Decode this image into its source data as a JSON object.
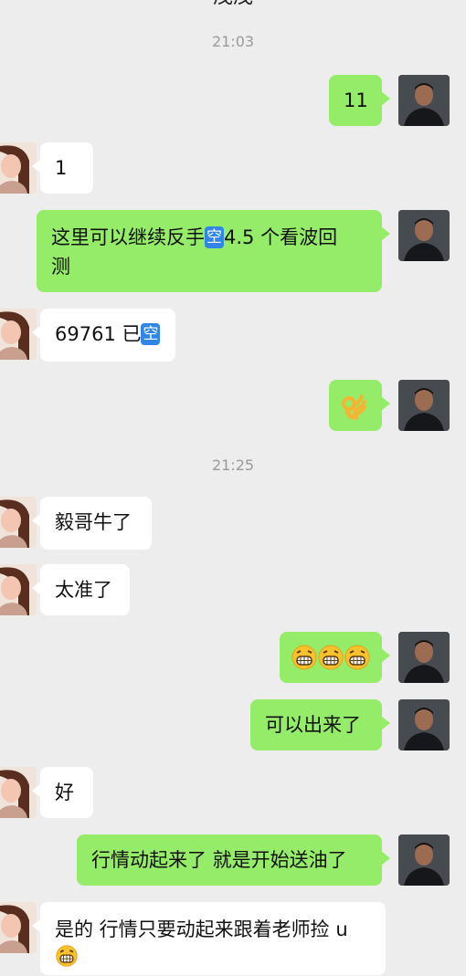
{
  "header": {
    "title": "茂茂"
  },
  "timestamps": [
    "21:03",
    "21:25"
  ],
  "messages": {
    "m1": "11",
    "m2": "1",
    "m3_a": "这里可以继续反手",
    "m3_badge": "空",
    "m3_b": "4.5 个看波回",
    "m3_c": "测",
    "m4_a": "69761 已",
    "m4_badge": "空",
    "m5_emoji": "ok-hand-emoji",
    "m6": "毅哥牛了",
    "m7": "太准了",
    "m8_emoji": "grinning-face-emoji x3",
    "m9": "可以出来了",
    "m10": "好",
    "m11": "行情动起来了 就是开始送油了",
    "m12_a": "是的 行情只要动起来跟着老师捡 u",
    "m12_emoji": "grinning-face-emoji"
  },
  "colors": {
    "background": "#ededed",
    "my_bubble": "#95ec69",
    "other_bubble": "#ffffff",
    "badge": "#2f86e6"
  }
}
